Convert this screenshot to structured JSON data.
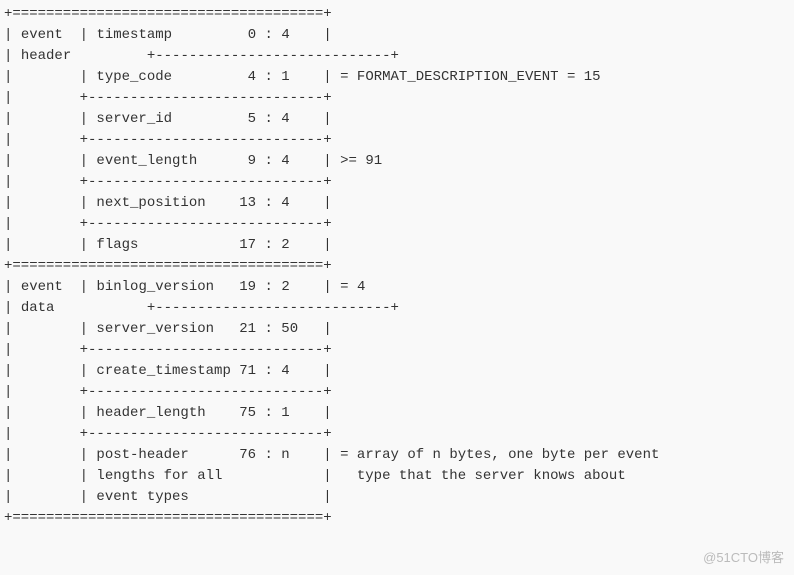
{
  "diagram": {
    "border_top": "+=====================================+",
    "header_sep": "        +----------------------------+",
    "sections": [
      {
        "group": "event",
        "group2": "header",
        "fields": [
          {
            "name": "timestamp",
            "offset": "0",
            "len": "4",
            "note": ""
          },
          {
            "name": "type_code",
            "offset": "4",
            "len": "1",
            "note": "= FORMAT_DESCRIPTION_EVENT = 15"
          },
          {
            "name": "server_id",
            "offset": "5",
            "len": "4",
            "note": ""
          },
          {
            "name": "event_length",
            "offset": "9",
            "len": "4",
            "note": ">= 91"
          },
          {
            "name": "next_position",
            "offset": "13",
            "len": "4",
            "note": ""
          },
          {
            "name": "flags",
            "offset": "17",
            "len": "2",
            "note": ""
          }
        ]
      },
      {
        "group": "event",
        "group2": "data",
        "fields": [
          {
            "name": "binlog_version",
            "offset": "19",
            "len": "2",
            "note": "= 4"
          },
          {
            "name": "server_version",
            "offset": "21",
            "len": "50",
            "note": ""
          },
          {
            "name": "create_timestamp",
            "offset": "71",
            "len": "4",
            "note": ""
          },
          {
            "name": "header_length",
            "offset": "75",
            "len": "1",
            "note": ""
          },
          {
            "name": "post-header",
            "offset": "76",
            "len": "n",
            "note": "= array of n bytes, one byte per event",
            "extra": [
              {
                "name": "lengths for all",
                "note": "  type that the server knows about"
              },
              {
                "name": "event types",
                "note": ""
              }
            ]
          }
        ]
      }
    ]
  },
  "watermark": "@51CTO博客"
}
